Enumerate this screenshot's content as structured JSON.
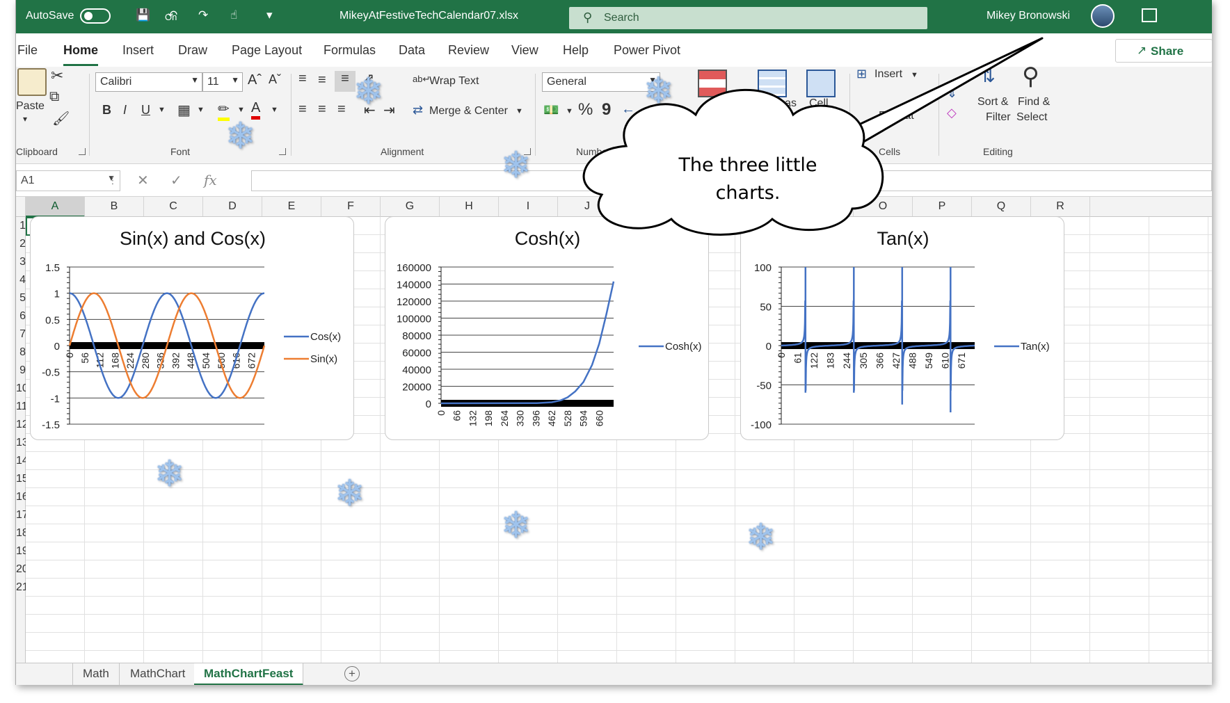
{
  "titlebar": {
    "autosave": "AutoSave",
    "toggle": "On",
    "filename": "MikeyAtFestiveTechCalendar07.xlsx",
    "search_placeholder": "Search",
    "user": "Mikey Bronowski"
  },
  "tabs": [
    "File",
    "Home",
    "Insert",
    "Draw",
    "Page Layout",
    "Formulas",
    "Data",
    "Review",
    "View",
    "Help",
    "Power Pivot"
  ],
  "active_tab": "Home",
  "share_label": "Share",
  "ribbon": {
    "clipboard": {
      "paste": "Paste",
      "label": "Clipboard"
    },
    "font": {
      "name": "Calibri",
      "size": "11",
      "bold": "B",
      "italic": "I",
      "underline": "U",
      "label": "Font"
    },
    "alignment": {
      "wrap": "Wrap Text",
      "merge": "Merge & Center",
      "label": "Alignment"
    },
    "number": {
      "format": "General",
      "percent": "%",
      "comma": "9",
      "label": "Number"
    },
    "styles": {
      "format_as_table_1": "Format as",
      "format_as_table_2": "Table",
      "cell_styles_1": "Cell"
    },
    "cells": {
      "insert": "Insert",
      "format": "Format",
      "label": "Cells"
    },
    "editing": {
      "sort_1": "Sort &",
      "sort_2": "Filter",
      "find_1": "Find &",
      "find_2": "Select",
      "label": "Editing"
    }
  },
  "formula_bar": {
    "name_box": "A1",
    "fx": "fx",
    "formula": ""
  },
  "columns": [
    "A",
    "B",
    "C",
    "D",
    "E",
    "F",
    "G",
    "H",
    "I",
    "J",
    "K",
    "L",
    "M",
    "N",
    "O",
    "P",
    "Q",
    "R"
  ],
  "rows": [
    "1",
    "2",
    "3",
    "4",
    "5",
    "6",
    "7",
    "8",
    "9",
    "10",
    "11",
    "12",
    "13",
    "14",
    "15",
    "16",
    "17",
    "18",
    "19",
    "20",
    "21"
  ],
  "sheets": [
    "Math",
    "MathChart",
    "MathChartFeast"
  ],
  "active_sheet": "MathChartFeast",
  "callout": {
    "line1": "The three little",
    "line2": "charts."
  },
  "colors": {
    "excel_green": "#217346",
    "series_blue": "#4472C4",
    "series_orange": "#ED7D31"
  },
  "chart_data": [
    {
      "type": "line",
      "title": "Sin(x) and Cos(x)",
      "x_ticks": [
        0,
        56,
        112,
        168,
        224,
        280,
        336,
        392,
        448,
        504,
        560,
        616,
        672
      ],
      "x_range": [
        0,
        720
      ],
      "ylim": [
        -1.5,
        1.5
      ],
      "y_ticks": [
        "1.5",
        "1",
        "0.5",
        "0",
        "-0.5",
        "-1",
        "-1.5"
      ],
      "series": [
        {
          "name": "Cos(x)",
          "color": "#4472C4",
          "function": "cos",
          "period": 180
        },
        {
          "name": "Sin(x)",
          "color": "#ED7D31",
          "function": "sin",
          "period": 180
        }
      ],
      "legend": "right",
      "grid": true
    },
    {
      "type": "line",
      "title": "Cosh(x)",
      "x_ticks": [
        0,
        66,
        132,
        198,
        264,
        330,
        396,
        462,
        528,
        594,
        660
      ],
      "x_range": [
        0,
        720
      ],
      "ylim": [
        0,
        160000
      ],
      "y_ticks": [
        "160000",
        "140000",
        "120000",
        "100000",
        "80000",
        "60000",
        "40000",
        "20000",
        "0"
      ],
      "series": [
        {
          "name": "Cosh(x)",
          "color": "#4472C4",
          "points": [
            [
              0,
              1
            ],
            [
              400,
              250
            ],
            [
              462,
              1200
            ],
            [
              500,
              3500
            ],
            [
              528,
              7000
            ],
            [
              560,
              14000
            ],
            [
              594,
              25000
            ],
            [
              630,
              45000
            ],
            [
              660,
              70000
            ],
            [
              690,
              105000
            ],
            [
              720,
              143000
            ]
          ]
        }
      ],
      "legend": "right",
      "grid": true
    },
    {
      "type": "line",
      "title": "Tan(x)",
      "x_ticks": [
        0,
        61,
        122,
        183,
        244,
        305,
        366,
        427,
        488,
        549,
        610,
        671
      ],
      "x_range": [
        0,
        720
      ],
      "ylim": [
        -100,
        100
      ],
      "y_ticks": [
        "100",
        "50",
        "0",
        "-50",
        "-100"
      ],
      "series": [
        {
          "name": "Tan(x)",
          "color": "#4472C4",
          "function": "tan",
          "period": 180,
          "asymptotes": [
            90,
            270,
            450,
            630
          ]
        }
      ],
      "legend": "right",
      "grid": true
    }
  ]
}
